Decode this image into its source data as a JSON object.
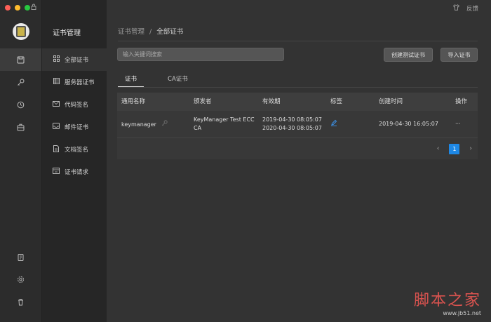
{
  "titlebar": {
    "colors": {
      "close": "#fe5f57",
      "minimize": "#febc2e",
      "maximize": "#28c840"
    }
  },
  "topbar": {
    "shirt_icon": "shirt-icon",
    "feedback_label": "反馈"
  },
  "nav": {
    "title": "证书管理",
    "items": [
      {
        "label": "全部证书",
        "icon": "grid-icon"
      },
      {
        "label": "服务器证书",
        "icon": "server-icon"
      },
      {
        "label": "代码签名",
        "icon": "mail-icon"
      },
      {
        "label": "邮件证书",
        "icon": "inbox-icon"
      },
      {
        "label": "文档签名",
        "icon": "document-icon"
      },
      {
        "label": "证书请求",
        "icon": "request-icon"
      }
    ]
  },
  "breadcrumb": {
    "parent": "证书管理",
    "separator": "/",
    "current": "全部证书"
  },
  "search": {
    "placeholder": "输入关键词搜索"
  },
  "buttons": {
    "create_test": "创建测试证书",
    "import": "导入证书"
  },
  "tabs": [
    {
      "label": "证书"
    },
    {
      "label": "CA证书"
    }
  ],
  "table": {
    "headers": [
      "通用名称",
      "颁发者",
      "有效期",
      "标签",
      "创建时间",
      "操作"
    ],
    "rows": [
      {
        "name": "keymanager",
        "issuer_line1": "KeyManager Test ECC",
        "issuer_line2": "CA",
        "valid_from": "2019-04-30 08:05:07",
        "valid_to": "2020-04-30 08:05:07",
        "created": "2019-04-30 16:05:07",
        "action": "···"
      }
    ]
  },
  "pager": {
    "prev": "‹",
    "current": "1",
    "next": "›"
  },
  "watermark": {
    "big": "脚本之家",
    "small": "www.jb51.net"
  },
  "accent": "#1e88e5"
}
